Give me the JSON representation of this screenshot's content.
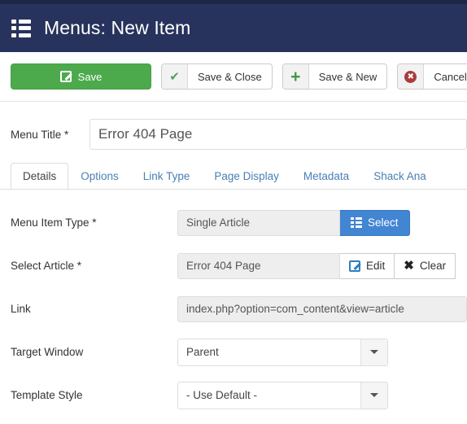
{
  "header": {
    "title": "Menus: New Item",
    "icon": "menu-list-icon",
    "bg_color": "#27335c",
    "top_strip_color": "#1d2647"
  },
  "toolbar": {
    "save": {
      "label": "Save",
      "icon": "edit-pencil-icon",
      "color": "#4caa4c"
    },
    "save_close": {
      "label": "Save & Close",
      "icon": "check-icon",
      "icon_color": "#5a9e5a"
    },
    "save_new": {
      "label": "Save & New",
      "icon": "plus-icon",
      "icon_color": "#3f9b3f"
    },
    "cancel": {
      "label": "Cancel",
      "icon": "cancel-circle-icon",
      "icon_color": "#a93c3c"
    }
  },
  "menu_title": {
    "label": "Menu Title *",
    "value": "Error 404 Page",
    "placeholder": ""
  },
  "tabs": [
    {
      "label": "Details",
      "active": true
    },
    {
      "label": "Options",
      "active": false
    },
    {
      "label": "Link Type",
      "active": false
    },
    {
      "label": "Page Display",
      "active": false
    },
    {
      "label": "Metadata",
      "active": false
    },
    {
      "label": "Shack Ana",
      "active": false
    }
  ],
  "fields": {
    "menu_item_type": {
      "label": "Menu Item Type *",
      "value": "Single Article",
      "button": {
        "label": "Select",
        "icon": "list-icon",
        "color": "#4285d3"
      }
    },
    "select_article": {
      "label": "Select Article *",
      "value": "Error 404 Page",
      "edit_button": {
        "label": "Edit",
        "icon": "edit-pencil-icon"
      },
      "clear_button": {
        "label": "Clear",
        "icon": "close-x-icon"
      }
    },
    "link": {
      "label": "Link",
      "value": "index.php?option=com_content&view=article"
    },
    "target_window": {
      "label": "Target Window",
      "value": "Parent"
    },
    "template_style": {
      "label": "Template Style",
      "value": "- Use Default -"
    }
  }
}
